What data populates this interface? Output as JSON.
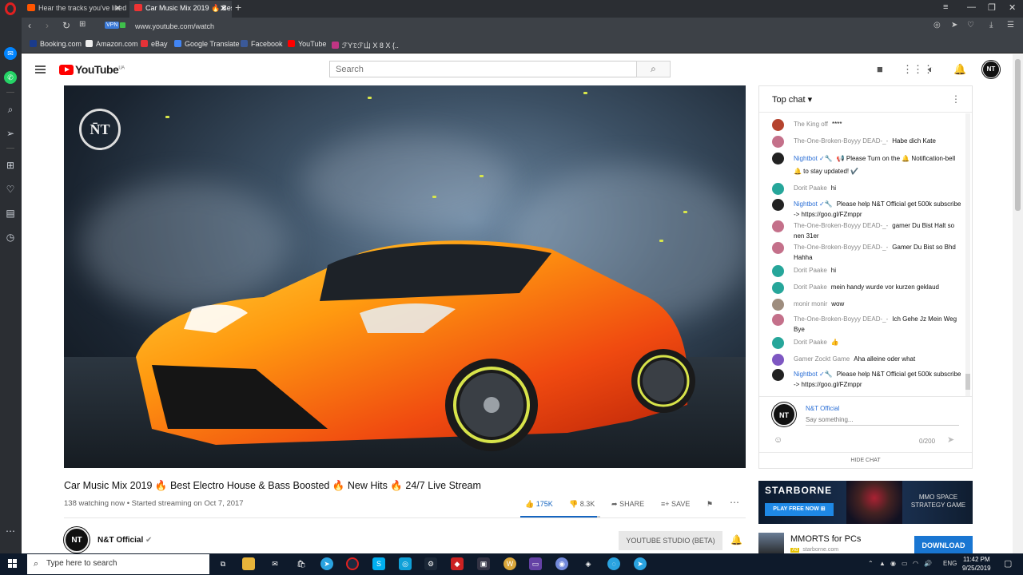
{
  "browser": {
    "tabs": [
      {
        "label": "Hear the tracks you've liked"
      },
      {
        "label": "Car Music Mix 2019 🔥 Best"
      }
    ],
    "vpn_label": "VPN",
    "url": "www.youtube.com/watch",
    "bookmarks": [
      {
        "label": "Booking.com",
        "color": "#1a3b8c"
      },
      {
        "label": "Amazon.com",
        "color": "#222222"
      },
      {
        "label": "eBay",
        "color": "#e53238"
      },
      {
        "label": "Google Translate",
        "color": "#4285f4"
      },
      {
        "label": "Facebook",
        "color": "#3b5998"
      },
      {
        "label": "YouTube",
        "color": "#ff0000"
      },
      {
        "label": "ℱY𝔇ℱ山 X 8 X {..",
        "color": "#c13584"
      }
    ]
  },
  "youtube": {
    "logo_text": "YouTube",
    "region": "UA",
    "search_placeholder": "Search",
    "channel_initials": "NT",
    "video": {
      "title": "Car Music Mix 2019 🔥 Best Electro House & Bass Boosted 🔥 New Hits 🔥 24/7 Live Stream",
      "meta": "138 watching now • Started streaming on Oct 7, 2017",
      "likes": "175K",
      "dislikes": "8.3K",
      "share_label": "SHARE",
      "save_label": "SAVE",
      "like_ratio": 0.955,
      "logo_text": "N̄T"
    },
    "channel": {
      "name": "N&T Official",
      "studio_button": "YOUTUBE STUDIO (BETA)"
    },
    "chat": {
      "title": "Top chat",
      "messages": [
        {
          "author": "The King off",
          "text": "****",
          "avatar_color": "#b5432e",
          "bot": false
        },
        {
          "author": "The-One-Broken-Boyyy DEAD-_-",
          "text": "Habe dich Kate",
          "avatar_color": "#c4708a",
          "bot": false
        },
        {
          "author": "Nightbot ✓🔧",
          "text": "📢 Please Turn on the 🔔 Notification-bell 🔔 to stay updated! ✔️",
          "avatar_color": "#222222",
          "bot": true
        },
        {
          "author": "Dorit Paake",
          "text": "hi",
          "avatar_color": "#26a69a",
          "bot": false
        },
        {
          "author": "Nightbot ✓🔧",
          "text": "Please help N&T Official get 500k subscribe -> https://goo.gl/FZmppr",
          "avatar_color": "#222222",
          "bot": true
        },
        {
          "author": "The-One-Broken-Boyyy DEAD-_-",
          "text": "gamer Du Bist Halt so nen 31er",
          "avatar_color": "#c4708a",
          "bot": false
        },
        {
          "author": "The-One-Broken-Boyyy DEAD-_-",
          "text": "Gamer Du Bist so Bhd Hahha",
          "avatar_color": "#c4708a",
          "bot": false
        },
        {
          "author": "Dorit Paake",
          "text": "hi",
          "avatar_color": "#26a69a",
          "bot": false
        },
        {
          "author": "Dorit Paake",
          "text": "mein handy wurde vor kurzen geklaud",
          "avatar_color": "#26a69a",
          "bot": false
        },
        {
          "author": "monir monir",
          "text": "wow",
          "avatar_color": "#9e8d7e",
          "bot": false
        },
        {
          "author": "The-One-Broken-Boyyy DEAD-_-",
          "text": "Ich Gehe Jz Mein Weg Bye",
          "avatar_color": "#c4708a",
          "bot": false
        },
        {
          "author": "Dorit Paake",
          "text": "👍",
          "avatar_color": "#26a69a",
          "bot": false
        },
        {
          "author": "Gamer Zockt Game",
          "text": "Aha alleine oder what",
          "avatar_color": "#7e57c2",
          "bot": false
        },
        {
          "author": "Nightbot ✓🔧",
          "text": "Please help N&T Official get 500k subscribe -> https://goo.gl/FZmppr",
          "avatar_color": "#222222",
          "bot": true
        }
      ],
      "input_name": "N&T Official",
      "input_placeholder": "Say something...",
      "char_count": "0/200",
      "hide_label": "HIDE CHAT"
    },
    "ads": {
      "banner_title": "STARBORNE",
      "banner_button": "PLAY FREE NOW ⊞",
      "banner_tagline": "MMO SPACE STRATEGY GAME",
      "promo_title": "MMORTS for PCs",
      "promo_badge": "Ad",
      "promo_domain": "starborne.com",
      "promo_button": "DOWNLOAD"
    }
  },
  "taskbar": {
    "search_text": "Type here to search",
    "language": "ENG",
    "time": "11:42 PM",
    "date": "9/25/2019"
  }
}
